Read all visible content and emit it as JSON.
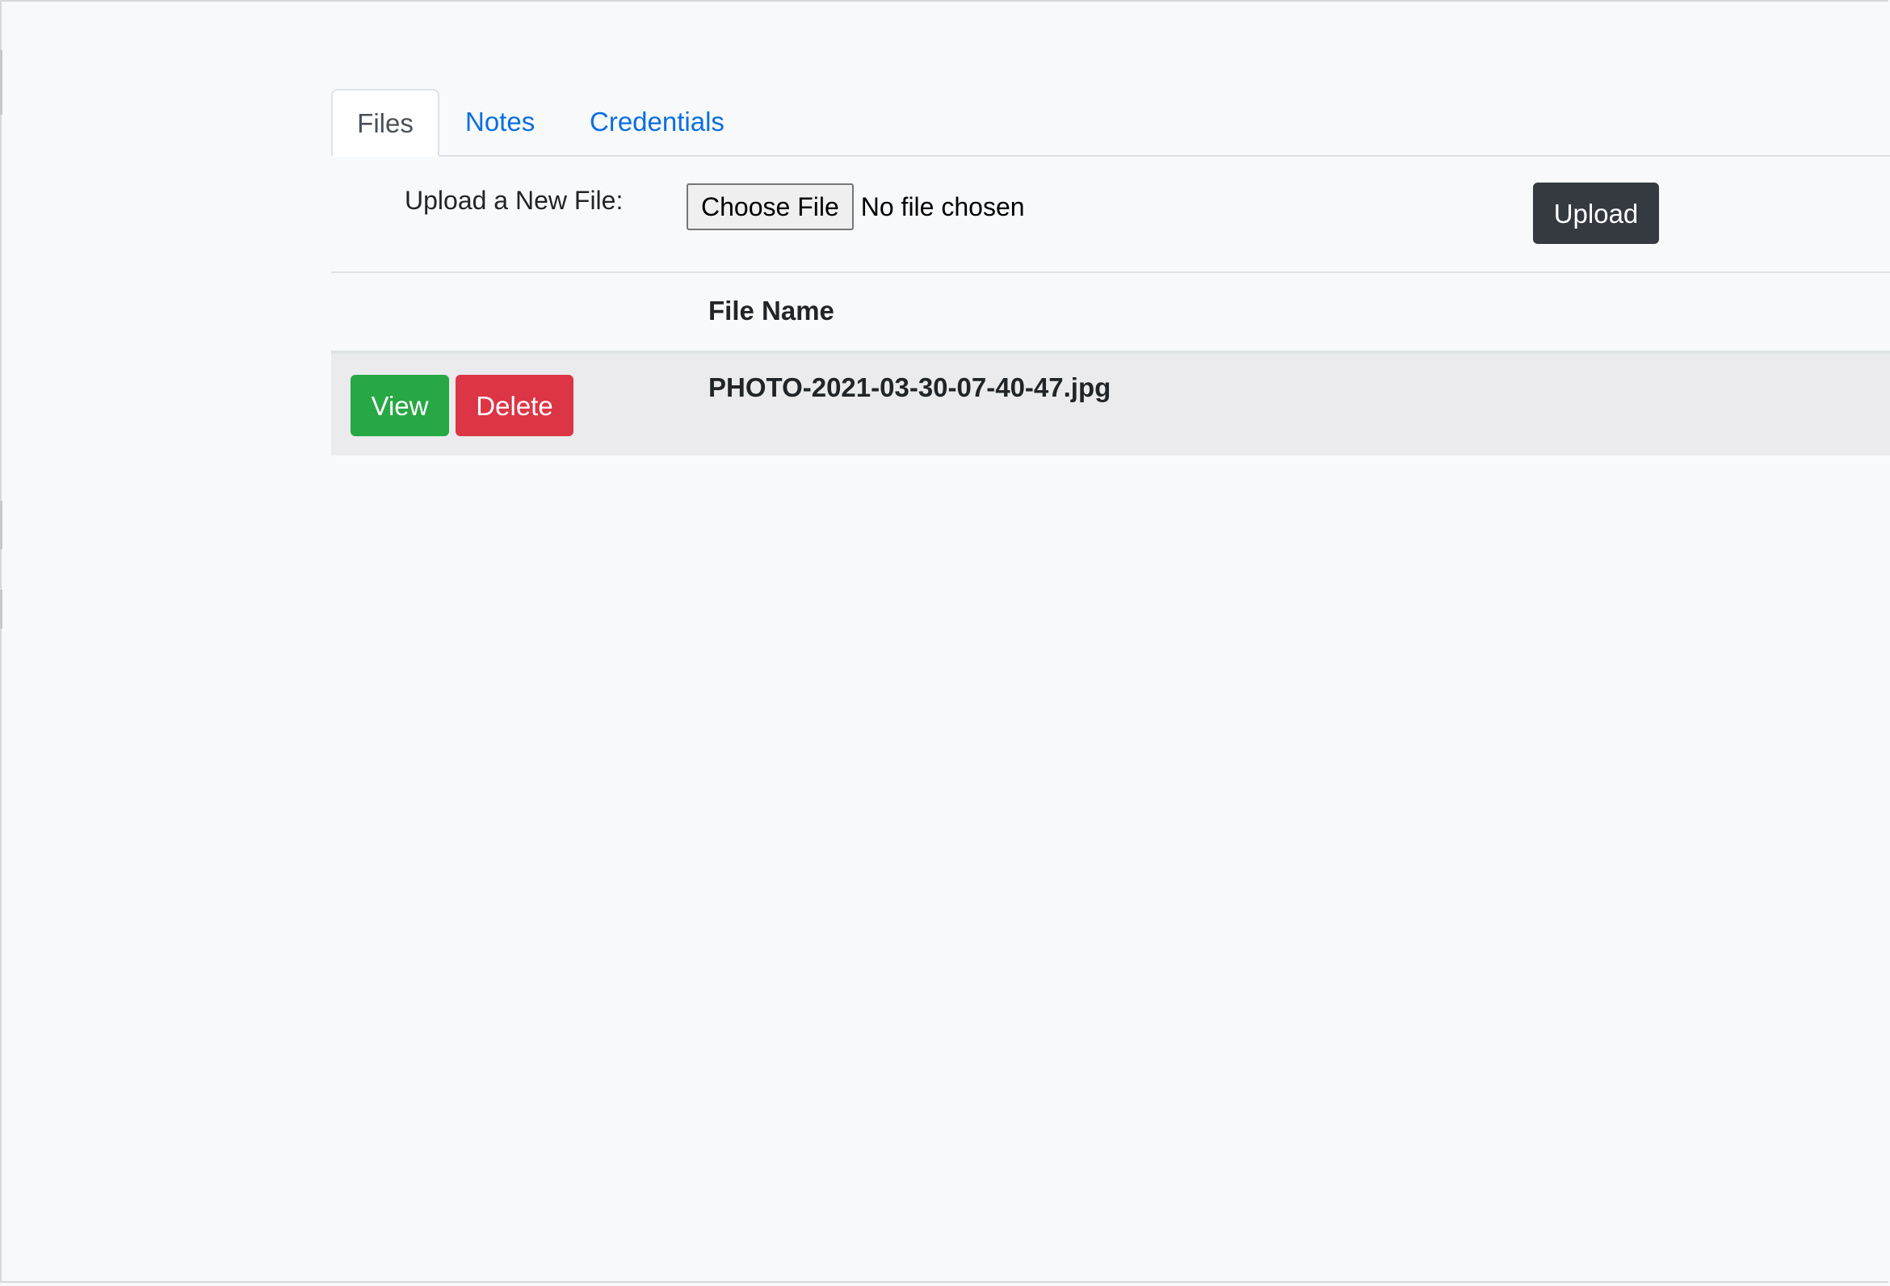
{
  "tabs": [
    {
      "label": "Files",
      "active": true
    },
    {
      "label": "Notes",
      "active": false
    },
    {
      "label": "Credentials",
      "active": false
    }
  ],
  "upload": {
    "label": "Upload a New File:",
    "choose_file_label": "Choose File",
    "no_file_text": "No file chosen",
    "upload_button_label": "Upload"
  },
  "table": {
    "columns": [
      "",
      "File Name"
    ],
    "rows": [
      {
        "view_label": "View",
        "delete_label": "Delete",
        "file_name": "PHOTO-2021-03-30-07-40-47.jpg"
      }
    ]
  },
  "colors": {
    "page_background": "#f8f9fa",
    "tab_link": "#0a6ee0",
    "upload_button": "#343a40",
    "view_button": "#28a745",
    "delete_button": "#dc3545",
    "row_background": "#ebebed"
  }
}
